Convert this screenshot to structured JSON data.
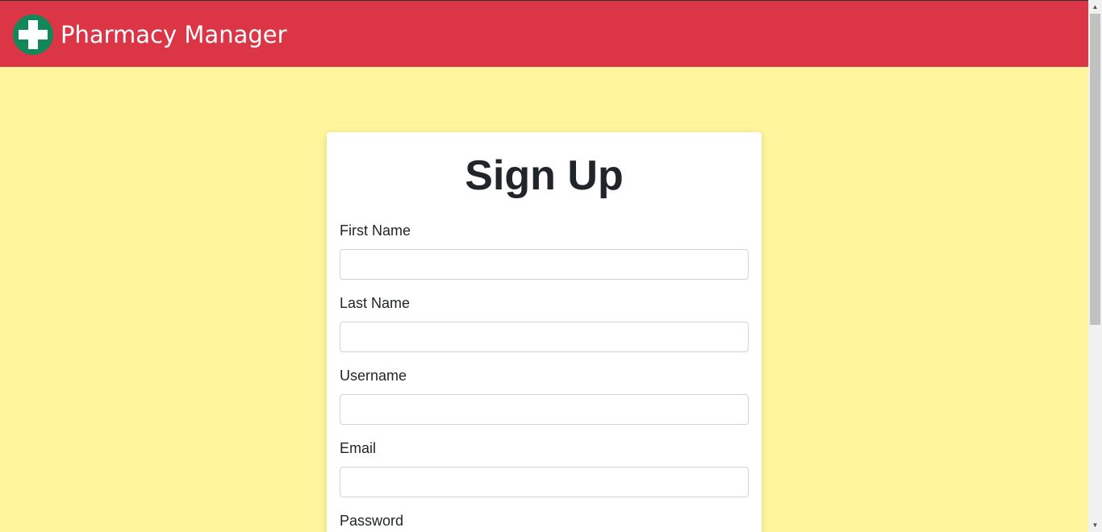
{
  "header": {
    "brand": "Pharmacy Manager",
    "logo_icon": "pharmacy-cross-icon",
    "colors": {
      "navbar": "#dc3545",
      "logo_circle": "#12875a",
      "logo_cross": "#ffffff",
      "page_background": "#fff59d"
    }
  },
  "form": {
    "title": "Sign Up",
    "fields": [
      {
        "label": "First Name",
        "value": "",
        "placeholder": ""
      },
      {
        "label": "Last Name",
        "value": "",
        "placeholder": ""
      },
      {
        "label": "Username",
        "value": "",
        "placeholder": ""
      },
      {
        "label": "Email",
        "value": "",
        "placeholder": ""
      },
      {
        "label": "Password"
      }
    ]
  },
  "scrollbar": {
    "up_icon": "scroll-up-arrow-icon",
    "down_icon": "scroll-down-arrow-icon"
  }
}
